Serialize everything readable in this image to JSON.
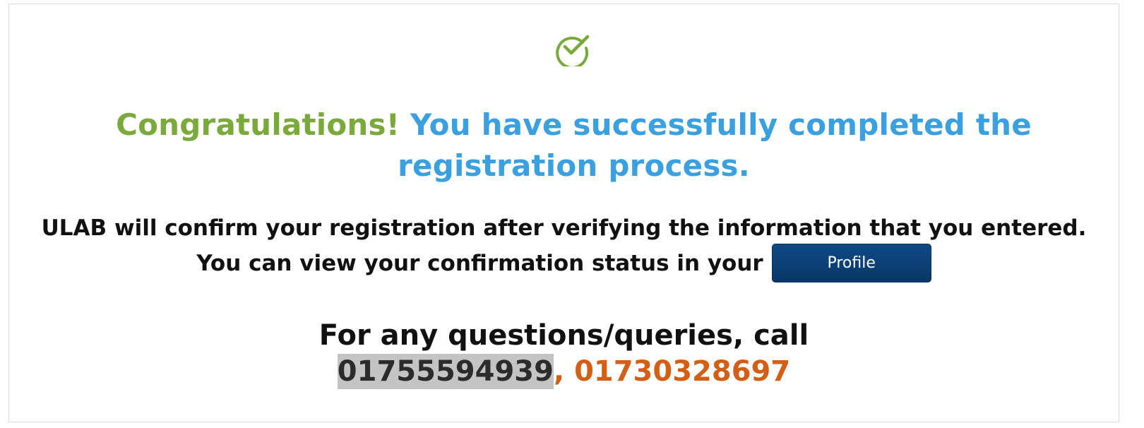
{
  "success": {
    "icon": "check-circle-icon",
    "icon_color": "#7aaa3c"
  },
  "headline": {
    "congrats": "Congratulations!",
    "message": "You have successfully completed the registration process.",
    "congrats_color": "#7aaa3c",
    "message_color": "#3aa0e0"
  },
  "info": {
    "line1": "ULAB will confirm your registration after verifying the information that you entered.",
    "line2": "You can view your confirmation status in your",
    "profile_button": "Profile"
  },
  "contact": {
    "prompt": "For any questions/queries, call",
    "phone1": "01755594939",
    "separator": ", ",
    "phone2": "01730328697",
    "phone2_color": "#d35f16"
  }
}
